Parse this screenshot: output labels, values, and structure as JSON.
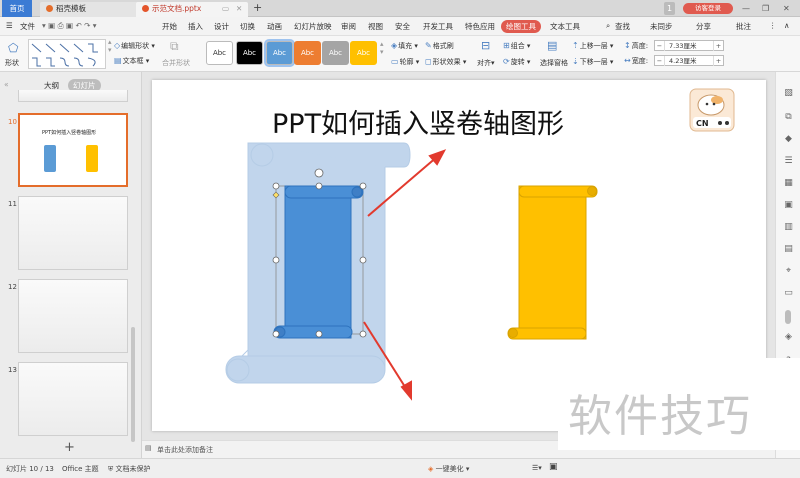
{
  "tabs": {
    "home": "首页",
    "template": "稻壳模板",
    "document": "示范文档.pptx",
    "add": "+"
  },
  "window": {
    "badge": "1",
    "login": "访客登录"
  },
  "menu": {
    "file": "文件",
    "items": [
      "开始",
      "插入",
      "设计",
      "切换",
      "动画",
      "幻灯片放映",
      "审阅",
      "视图",
      "安全",
      "开发工具",
      "特色应用",
      "绘图工具",
      "文本工具"
    ],
    "active": "绘图工具",
    "search": "查找",
    "sync": "未同步",
    "share": "分享",
    "comment": "批注"
  },
  "ribbon": {
    "shape": "形状",
    "edit_shape": "编辑形状",
    "text_box": "文本框",
    "merge_shape": "合并形状",
    "style_label": "Abc",
    "fill": "填充",
    "format_brush": "格式刷",
    "outline": "轮廓",
    "shape_effect": "形状效果",
    "align": "对齐",
    "group": "组合",
    "rotate": "旋转",
    "select_pane": "选择窗格",
    "bring_forward": "上移一层",
    "send_backward": "下移一层",
    "height_label": "高度:",
    "height_value": "7.33厘米",
    "width_label": "宽度:",
    "width_value": "4.23厘米"
  },
  "left_panel": {
    "outline_tab": "大纲",
    "slides_tab": "幻灯片",
    "slide_numbers": [
      "10",
      "11",
      "12",
      "13"
    ],
    "thumb_title": "PPT如何插入竖卷轴图形",
    "add": "+"
  },
  "slide": {
    "title": "PPT如何插入竖卷轴图形",
    "logo_text": "CN"
  },
  "notes": {
    "placeholder": "单击此处添加备注"
  },
  "status": {
    "slide_count": "幻灯片 10 / 13",
    "theme": "Office 主题",
    "protect": "文档未保护",
    "beautify": "一键美化"
  },
  "watermark": "软件技巧",
  "colors": {
    "accent": "#e05a4f",
    "blue_scroll": "#5b9bd5",
    "yellow_scroll": "#ffc000",
    "arrow": "#e74c3c"
  }
}
